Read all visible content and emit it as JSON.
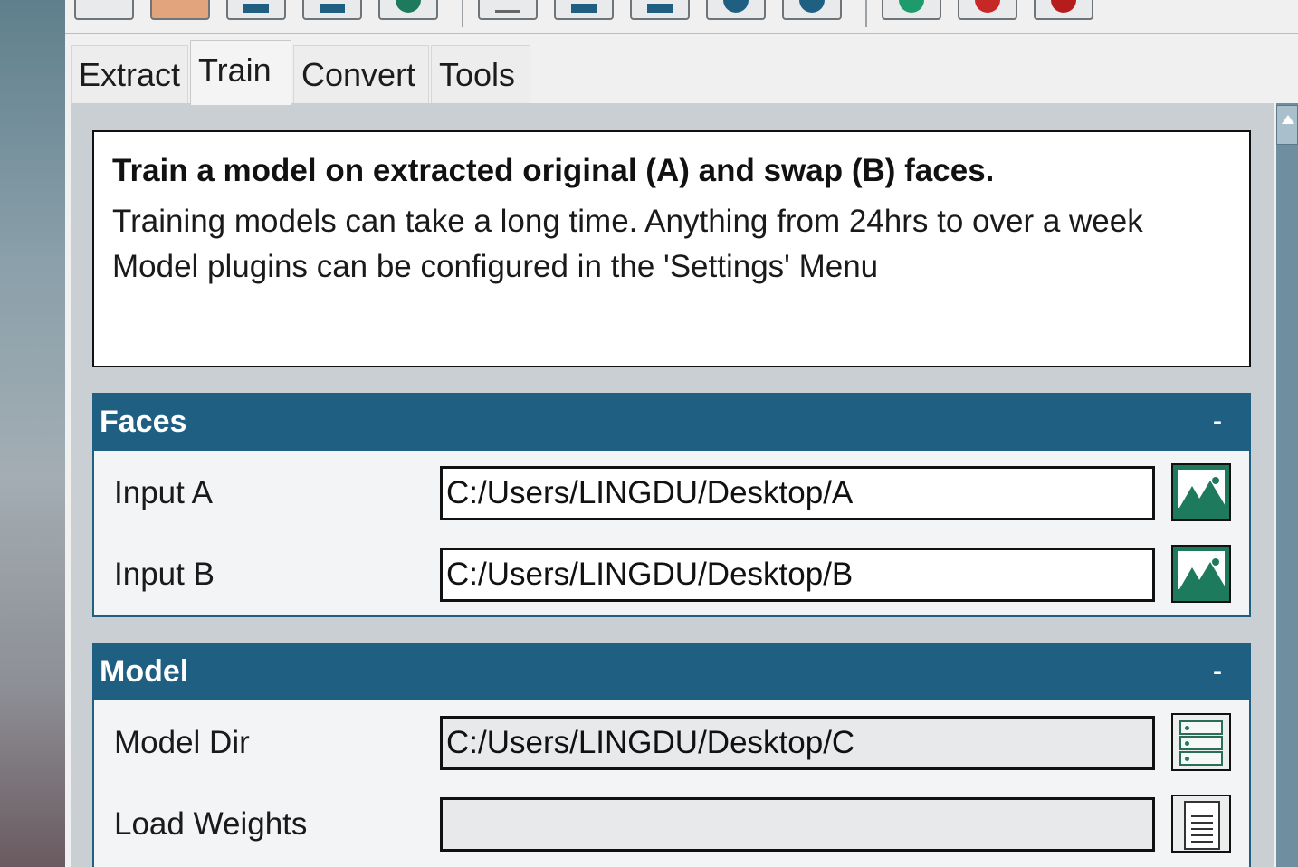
{
  "tabs": [
    {
      "label": "Extract",
      "active": false
    },
    {
      "label": "Train",
      "active": true
    },
    {
      "label": "Convert",
      "active": false
    },
    {
      "label": "Tools",
      "active": false
    }
  ],
  "info": {
    "title": "Train a model on extracted original (A) and swap (B) faces.",
    "line1": "Training models can take a long time. Anything from 24hrs to over a week",
    "line2": "Model plugins can be configured in the 'Settings' Menu"
  },
  "faces": {
    "title": "Faces",
    "collapse": "-",
    "input_a": {
      "label": "Input A",
      "value": "C:/Users/LINGDU/Desktop/A"
    },
    "input_b": {
      "label": "Input B",
      "value": "C:/Users/LINGDU/Desktop/B"
    }
  },
  "model": {
    "title": "Model",
    "collapse": "-",
    "model_dir": {
      "label": "Model Dir",
      "value": "C:/Users/LINGDU/Desktop/C"
    },
    "load_weights": {
      "label": "Load Weights",
      "value": ""
    }
  },
  "colors": {
    "section_header": "#1f5f82",
    "button_green": "#1e7a5c"
  },
  "toolbar_icons": [
    "settings-icon",
    "folder-icon",
    "save-icon",
    "save-as-icon",
    "back-icon",
    "text-icon",
    "save-icon",
    "save-as-icon",
    "close-icon",
    "back-icon",
    "green-action-icon",
    "red-action-icon",
    "stop-icon"
  ]
}
